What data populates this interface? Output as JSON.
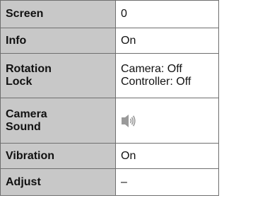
{
  "rows": [
    {
      "label": "Screen",
      "value": "0"
    },
    {
      "label": "Info",
      "value": "On"
    },
    {
      "label_lines": [
        "Rotation",
        "Lock"
      ],
      "value_lines": [
        "Camera: Off",
        "Controller: Off"
      ]
    },
    {
      "label_lines": [
        "Camera",
        "Sound"
      ],
      "value_icon": "speaker-volume-icon"
    },
    {
      "label": "Vibration",
      "value": "On"
    },
    {
      "label": "Adjust",
      "value": "–"
    }
  ],
  "colors": {
    "label_cell_bg": "#c8c8c8",
    "value_cell_bg": "#ffffff",
    "border": "#6f6f6f",
    "icon": "#9a9a9a"
  }
}
